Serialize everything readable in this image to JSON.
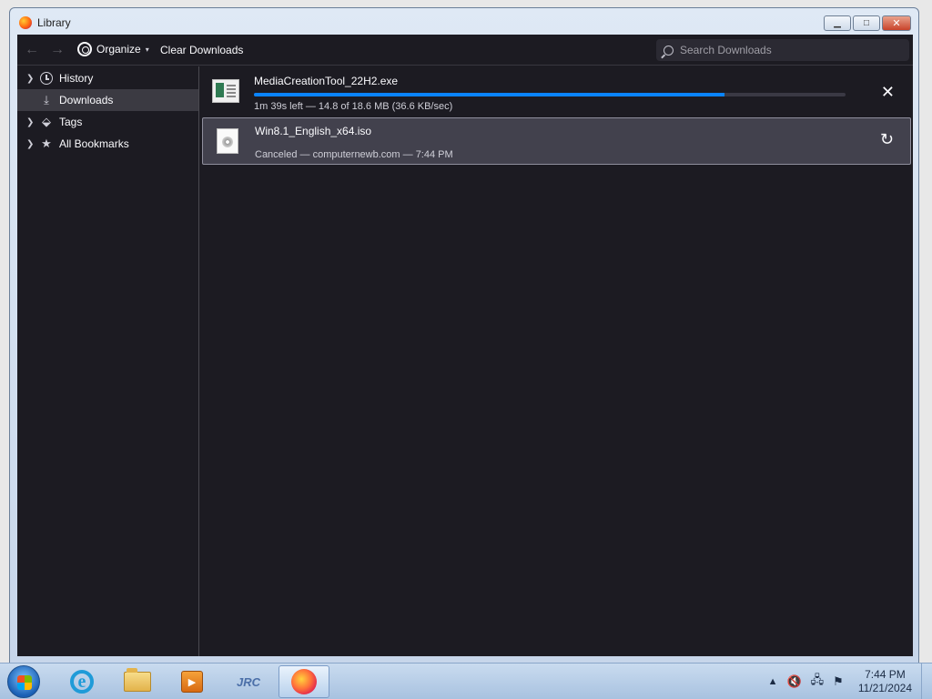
{
  "window": {
    "title": "Library"
  },
  "toolbar": {
    "back_icon": "arrow-left-icon",
    "forward_icon": "arrow-right-icon",
    "organize_label": "Organize",
    "clear_downloads_label": "Clear Downloads",
    "search_placeholder": "Search Downloads",
    "search_value": ""
  },
  "sidebar": {
    "items": [
      {
        "label": "History",
        "icon": "clock-icon",
        "expandable": true,
        "selected": false
      },
      {
        "label": "Downloads",
        "icon": "download-icon",
        "expandable": false,
        "selected": true
      },
      {
        "label": "Tags",
        "icon": "tag-icon",
        "expandable": true,
        "selected": false
      },
      {
        "label": "All Bookmarks",
        "icon": "star-icon",
        "expandable": true,
        "selected": false
      }
    ]
  },
  "downloads": [
    {
      "name": "MediaCreationTool_22H2.exe",
      "status": "1m 39s left — 14.8 of 18.6 MB (36.6 KB/sec)",
      "progress": 0.796,
      "action_icon": "close-icon",
      "file_icon": "exe-file-icon",
      "selected": false
    },
    {
      "name": "Win8.1_English_x64.iso",
      "status": "Canceled — computernewb.com — 7:44 PM",
      "action_icon": "retry-icon",
      "file_icon": "iso-file-icon",
      "selected": true
    }
  ],
  "taskbar": {
    "apps": [
      {
        "name": "internet-explorer",
        "icon": "ie-icon"
      },
      {
        "name": "file-explorer",
        "icon": "folder-icon"
      },
      {
        "name": "media-player",
        "icon": "media-player-icon"
      },
      {
        "name": "jrc",
        "icon": "jrc-icon",
        "text": "JRC"
      },
      {
        "name": "firefox",
        "icon": "firefox-icon",
        "active": true
      }
    ],
    "clock_time": "7:44 PM",
    "clock_date": "11/21/2024"
  },
  "colors": {
    "client_bg": "#1c1b22",
    "selected_bg": "#42414d",
    "progress_accent": "#0a84ff",
    "text_primary": "#fbfbfe"
  }
}
